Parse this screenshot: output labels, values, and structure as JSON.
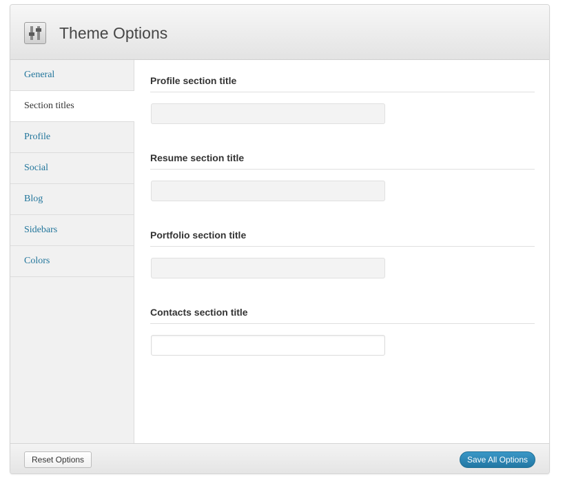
{
  "header": {
    "title": "Theme Options",
    "icon": "settings-sliders-icon"
  },
  "sidebar": {
    "items": [
      {
        "label": "General",
        "active": false
      },
      {
        "label": "Section titles",
        "active": true
      },
      {
        "label": "Profile",
        "active": false
      },
      {
        "label": "Social",
        "active": false
      },
      {
        "label": "Blog",
        "active": false
      },
      {
        "label": "Sidebars",
        "active": false
      },
      {
        "label": "Colors",
        "active": false
      }
    ]
  },
  "fields": [
    {
      "label": "Profile section title",
      "value": ""
    },
    {
      "label": "Resume section title",
      "value": ""
    },
    {
      "label": "Portfolio section title",
      "value": ""
    },
    {
      "label": "Contacts section title",
      "value": ""
    }
  ],
  "footer": {
    "reset_label": "Reset Options",
    "save_label": "Save All Options"
  },
  "colors": {
    "link": "#21759b",
    "primary_button": "#2a82b0",
    "sidebar_bg": "#f1f1f1"
  }
}
